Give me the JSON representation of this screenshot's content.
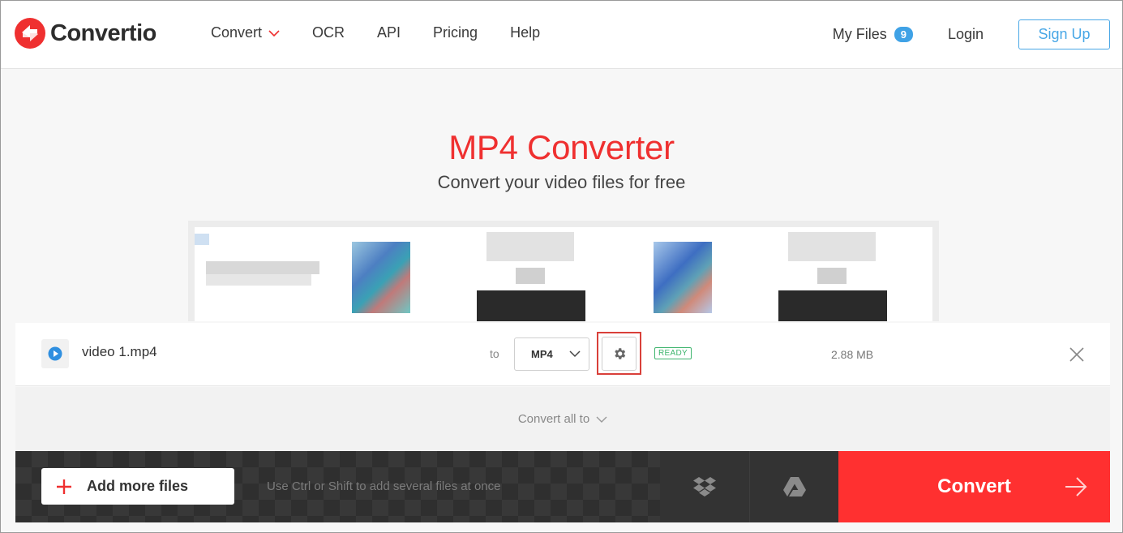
{
  "brand": {
    "name": "Convertio",
    "accent": "#ef3030"
  },
  "nav": {
    "items": [
      {
        "label": "Convert",
        "has_dropdown": true
      },
      {
        "label": "OCR"
      },
      {
        "label": "API"
      },
      {
        "label": "Pricing"
      },
      {
        "label": "Help"
      }
    ],
    "my_files": {
      "label": "My Files",
      "count": "9"
    },
    "login": "Login",
    "signup": "Sign Up"
  },
  "hero": {
    "title": "MP4 Converter",
    "subtitle": "Convert your video files for free"
  },
  "file": {
    "name": "video 1.mp4",
    "to_label": "to",
    "format": "MP4",
    "status": "READY",
    "size": "2.88 MB",
    "icon": "play-circle-icon"
  },
  "convert_all": {
    "label": "Convert all to"
  },
  "bottom": {
    "add_files": "Add more files",
    "hint": "Use Ctrl or Shift to add several files at once",
    "convert": "Convert"
  },
  "colors": {
    "link_blue": "#48a7e6",
    "badge_blue": "#3fa2e6",
    "ready_green": "#3fb56e",
    "convert_red": "#ff3030"
  }
}
